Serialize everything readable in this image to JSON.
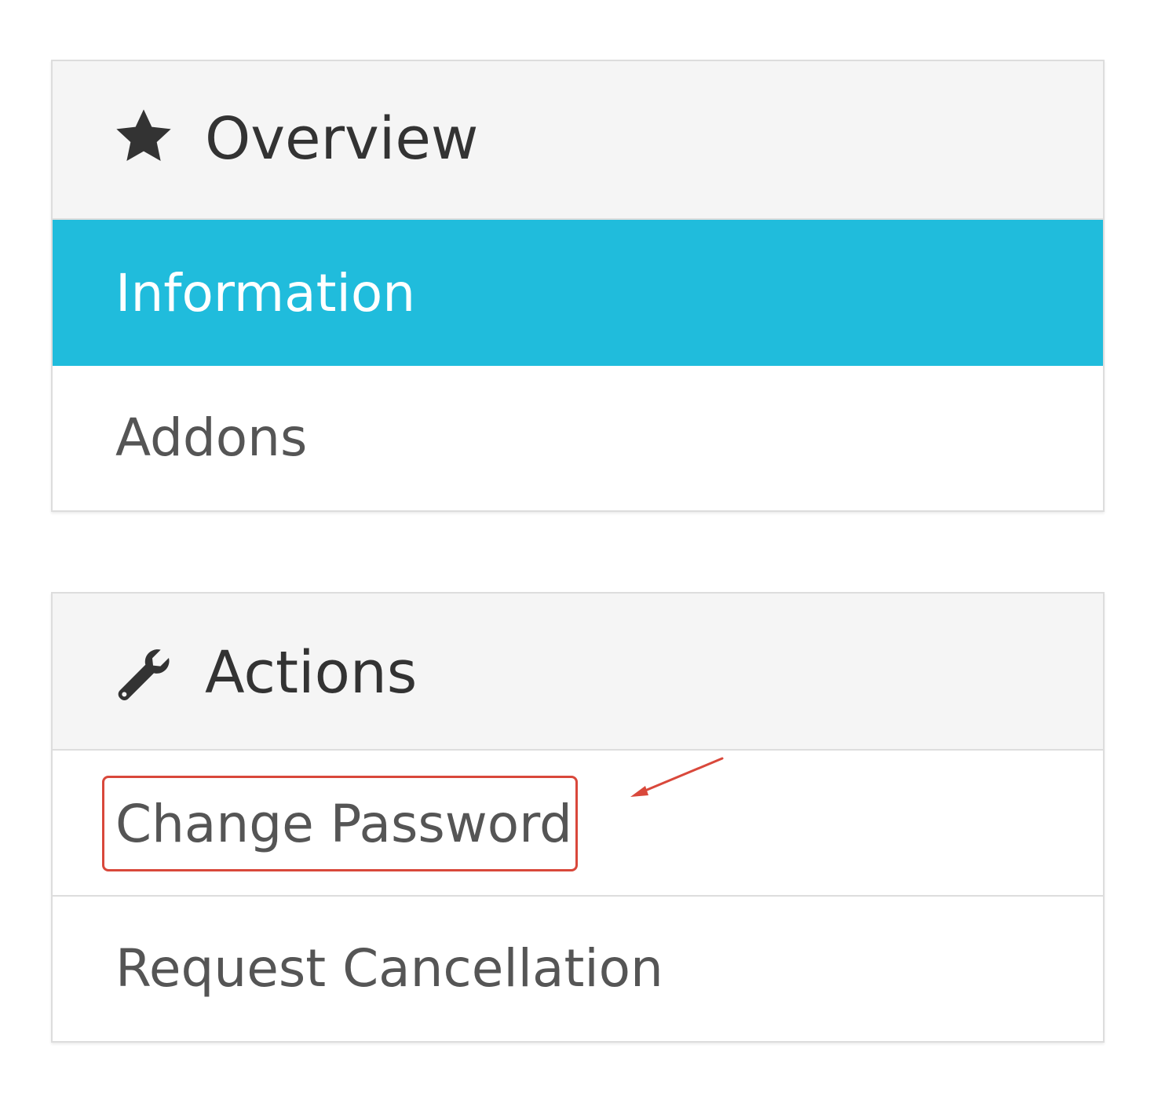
{
  "overview": {
    "icon": "star-icon",
    "title": "Overview",
    "items": [
      {
        "label": "Information",
        "active": true
      },
      {
        "label": "Addons",
        "active": false
      }
    ]
  },
  "actions": {
    "icon": "wrench-icon",
    "title": "Actions",
    "items": [
      {
        "label": "Change Password",
        "highlighted": true
      },
      {
        "label": "Request Cancellation",
        "highlighted": false
      }
    ]
  },
  "annotation": {
    "type": "arrow",
    "points_to": "Change Password",
    "color": "#d9483b"
  },
  "colors": {
    "active_background": "#20bcdc",
    "heading_background": "#f5f5f5",
    "heading_text": "#333333",
    "item_text": "#555555",
    "border": "#dddddd"
  }
}
